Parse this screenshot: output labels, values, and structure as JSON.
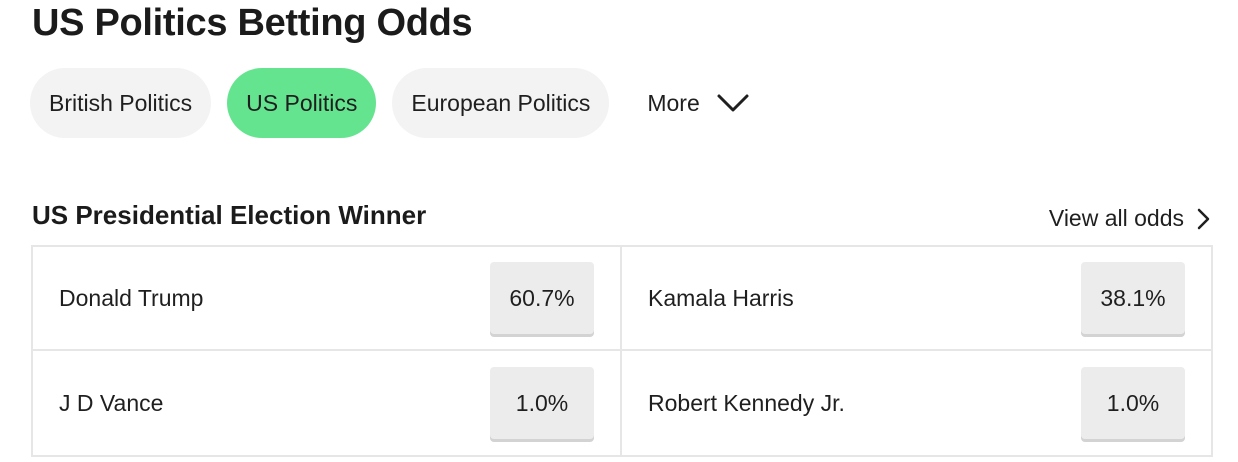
{
  "page": {
    "title": "US Politics Betting Odds"
  },
  "tabs": [
    {
      "label": "British Politics",
      "active": false
    },
    {
      "label": "US Politics",
      "active": true
    },
    {
      "label": "European Politics",
      "active": false
    }
  ],
  "more": {
    "label": "More",
    "icon": "chevron-down-icon"
  },
  "market": {
    "title": "US Presidential Election Winner",
    "view_all_label": "View all odds",
    "view_all_icon": "chevron-right-icon",
    "runners": [
      {
        "name": "Donald Trump",
        "odds": "60.7%"
      },
      {
        "name": "Kamala Harris",
        "odds": "38.1%"
      },
      {
        "name": "J D Vance",
        "odds": "1.0%"
      },
      {
        "name": "Robert Kennedy Jr.",
        "odds": "1.0%"
      }
    ]
  },
  "colors": {
    "active_tab": "#65e48f",
    "tab_bg": "#f2f3f2",
    "odds_bg": "#ececec"
  }
}
